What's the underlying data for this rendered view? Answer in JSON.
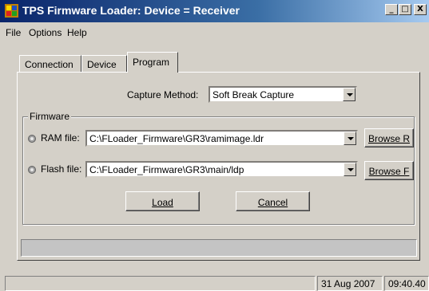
{
  "window": {
    "title": "TPS Firmware Loader: Device = Receiver",
    "controls": {
      "minimize": "_",
      "maximize": "□",
      "close": "X"
    }
  },
  "menu": {
    "items": [
      "File",
      "Options",
      "Help"
    ]
  },
  "tabs": [
    {
      "label": "Connection",
      "active": false
    },
    {
      "label": "Device",
      "active": false
    },
    {
      "label": "Program",
      "active": true
    }
  ],
  "program": {
    "capture_method_label": "Capture Method:",
    "capture_method_value": "Soft Break Capture",
    "firmware_group_label": "Firmware",
    "ram_file_label": "RAM file:",
    "ram_file_value": "C:\\FLoader_Firmware\\GR3\\ramimage.ldr",
    "browse_r_label": "Browse R",
    "flash_file_label": "Flash file:",
    "flash_file_value": "C:\\FLoader_Firmware\\GR3\\main/ldp",
    "browse_f_label": "Browse F",
    "load_label": "Load",
    "cancel_label": "Cancel",
    "progress_percent": 0
  },
  "statusbar": {
    "message": "",
    "date": "31 Aug 2007",
    "time": "09:40.40"
  },
  "colors": {
    "titlebar_start": "#0a246a",
    "titlebar_end": "#a6caf0",
    "face": "#d4d0c8"
  }
}
